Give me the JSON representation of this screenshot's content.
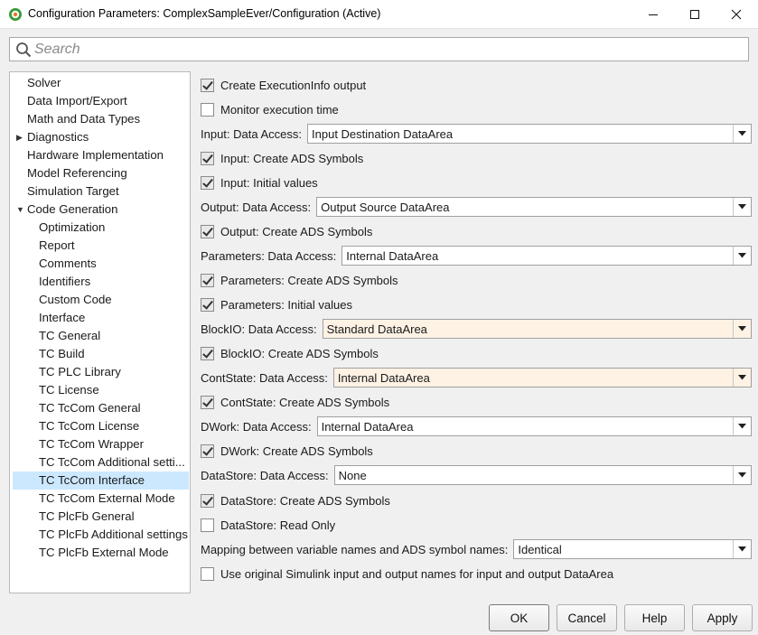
{
  "window": {
    "title": "Configuration Parameters: ComplexSampleEver/Configuration (Active)",
    "icon": "matlab-gear-icon",
    "controls": [
      "minimize-icon",
      "maximize-icon",
      "close-icon"
    ]
  },
  "search": {
    "placeholder": "Search",
    "value": ""
  },
  "tree": {
    "items": [
      {
        "label": "Solver",
        "level": 0
      },
      {
        "label": "Data Import/Export",
        "level": 0
      },
      {
        "label": "Math and Data Types",
        "level": 0
      },
      {
        "label": "Diagnostics",
        "level": 0,
        "expander": "collapsed"
      },
      {
        "label": "Hardware Implementation",
        "level": 0
      },
      {
        "label": "Model Referencing",
        "level": 0
      },
      {
        "label": "Simulation Target",
        "level": 0
      },
      {
        "label": "Code Generation",
        "level": 0,
        "expander": "expanded"
      },
      {
        "label": "Optimization",
        "level": 1
      },
      {
        "label": "Report",
        "level": 1
      },
      {
        "label": "Comments",
        "level": 1
      },
      {
        "label": "Identifiers",
        "level": 1
      },
      {
        "label": "Custom Code",
        "level": 1
      },
      {
        "label": "Interface",
        "level": 1
      },
      {
        "label": "TC General",
        "level": 1
      },
      {
        "label": "TC Build",
        "level": 1
      },
      {
        "label": "TC PLC Library",
        "level": 1
      },
      {
        "label": "TC License",
        "level": 1
      },
      {
        "label": "TC TcCom General",
        "level": 1
      },
      {
        "label": "TC TcCom License",
        "level": 1
      },
      {
        "label": "TC TcCom Wrapper",
        "level": 1
      },
      {
        "label": "TC TcCom Additional setti...",
        "level": 1
      },
      {
        "label": "TC TcCom Interface",
        "level": 1,
        "selected": true
      },
      {
        "label": "TC TcCom External Mode",
        "level": 1
      },
      {
        "label": "TC PlcFb General",
        "level": 1
      },
      {
        "label": "TC PlcFb Additional settings",
        "level": 1
      },
      {
        "label": "TC PlcFb External Mode",
        "level": 1
      }
    ]
  },
  "settings": [
    {
      "type": "checkbox",
      "label": "Create ExecutionInfo output",
      "checked": true
    },
    {
      "type": "checkbox",
      "label": "Monitor execution time",
      "checked": false
    },
    {
      "type": "dropdown",
      "label": "Input: Data Access:",
      "value": "Input Destination DataArea",
      "highlight": false
    },
    {
      "type": "checkbox",
      "label": "Input: Create ADS Symbols",
      "checked": true
    },
    {
      "type": "checkbox",
      "label": "Input: Initial values",
      "checked": true
    },
    {
      "type": "dropdown",
      "label": "Output: Data Access:",
      "value": "Output Source DataArea",
      "highlight": false
    },
    {
      "type": "checkbox",
      "label": "Output: Create ADS Symbols",
      "checked": true
    },
    {
      "type": "dropdown",
      "label": "Parameters: Data Access:",
      "value": "Internal DataArea",
      "highlight": false
    },
    {
      "type": "checkbox",
      "label": "Parameters: Create ADS Symbols",
      "checked": true
    },
    {
      "type": "checkbox",
      "label": "Parameters: Initial values",
      "checked": true
    },
    {
      "type": "dropdown",
      "label": "BlockIO: Data Access:",
      "value": "Standard DataArea",
      "highlight": true
    },
    {
      "type": "checkbox",
      "label": "BlockIO: Create ADS Symbols",
      "checked": true
    },
    {
      "type": "dropdown",
      "label": "ContState: Data Access:",
      "value": "Internal DataArea",
      "highlight": true
    },
    {
      "type": "checkbox",
      "label": "ContState: Create ADS Symbols",
      "checked": true
    },
    {
      "type": "dropdown",
      "label": "DWork: Data Access:",
      "value": "Internal DataArea",
      "highlight": false
    },
    {
      "type": "checkbox",
      "label": "DWork: Create ADS Symbols",
      "checked": true
    },
    {
      "type": "dropdown",
      "label": "DataStore: Data Access:",
      "value": "None",
      "highlight": false
    },
    {
      "type": "checkbox",
      "label": "DataStore: Create ADS Symbols",
      "checked": true
    },
    {
      "type": "checkbox",
      "label": "DataStore: Read Only",
      "checked": false
    },
    {
      "type": "dropdown",
      "label": "Mapping between variable names and ADS symbol names:",
      "value": "Identical",
      "highlight": false
    },
    {
      "type": "checkbox",
      "label": "Use original Simulink input and output names for input and output DataArea",
      "checked": false
    }
  ],
  "footer": {
    "ok_label": "OK",
    "cancel_label": "Cancel",
    "help_label": "Help",
    "apply_label": "Apply"
  },
  "colors": {
    "selection": "#cce8ff",
    "highlight_dropdown": "#fdf2e4",
    "panel_bg": "#f0f0f0"
  }
}
